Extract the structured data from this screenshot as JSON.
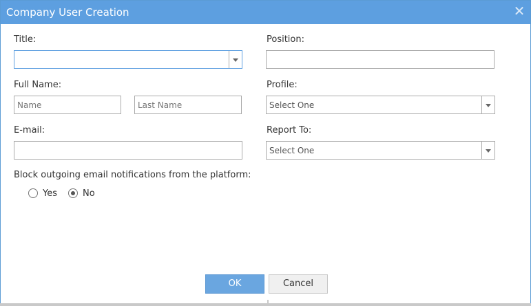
{
  "dialog": {
    "title": "Company User Creation",
    "close_icon": "close-icon"
  },
  "form": {
    "title_label": "Title:",
    "title_value": "",
    "position_label": "Position:",
    "position_value": "",
    "fullname_label": "Full Name:",
    "first_name_placeholder": "Name",
    "last_name_placeholder": "Last Name",
    "profile_label": "Profile:",
    "profile_value": "Select One",
    "email_label": "E-mail:",
    "email_value": "",
    "report_to_label": "Report To:",
    "report_to_value": "Select One",
    "block_label": "Block outgoing email notifications from the platform:",
    "block_options": [
      {
        "label": "Yes",
        "checked": false
      },
      {
        "label": "No",
        "checked": true
      }
    ]
  },
  "buttons": {
    "ok_label": "OK",
    "cancel_label": "Cancel"
  },
  "colors": {
    "titlebar": "#5d9fe0",
    "ok_button": "#6aa6e0"
  }
}
